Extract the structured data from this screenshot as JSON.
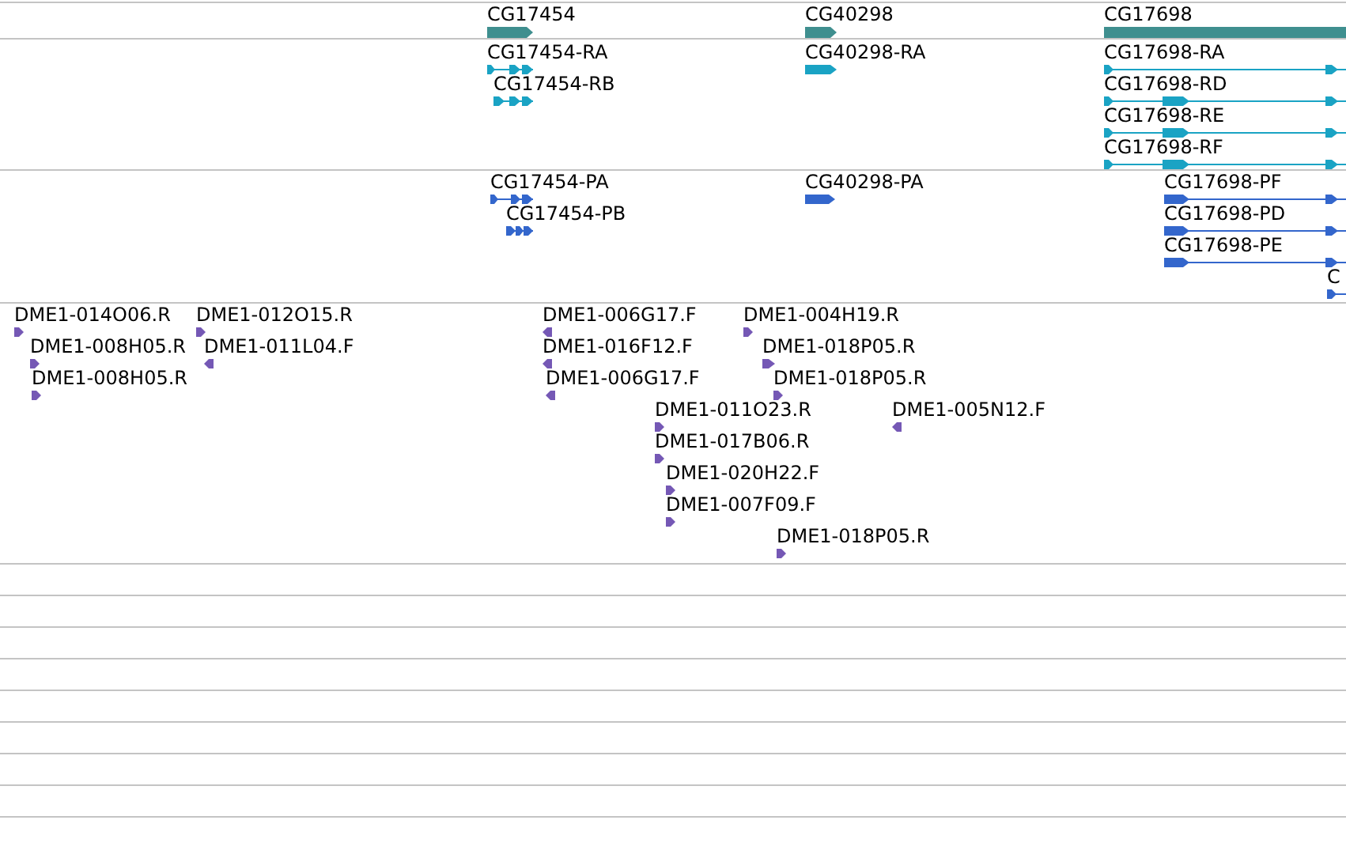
{
  "tracks": [
    {
      "kind": "gene",
      "features": [
        {
          "label": "CG17454",
          "forward": true
        },
        {
          "label": "CG40298",
          "forward": true
        },
        {
          "label": "CG17698",
          "forward": true
        }
      ]
    },
    {
      "kind": "transcript",
      "features": [
        {
          "label": "CG17454-RA",
          "forward": true
        },
        {
          "label": "CG17454-RB",
          "forward": true
        },
        {
          "label": "CG40298-RA",
          "forward": true
        },
        {
          "label": "CG17698-RA",
          "forward": true
        },
        {
          "label": "CG17698-RD",
          "forward": true
        },
        {
          "label": "CG17698-RE",
          "forward": true
        },
        {
          "label": "CG17698-RF",
          "forward": true
        }
      ]
    },
    {
      "kind": "protein",
      "features": [
        {
          "label": "CG17454-PA",
          "forward": true
        },
        {
          "label": "CG17454-PB",
          "forward": true
        },
        {
          "label": "CG40298-PA",
          "forward": true
        },
        {
          "label": "CG17698-PF",
          "forward": true
        },
        {
          "label": "CG17698-PD",
          "forward": true
        },
        {
          "label": "CG17698-PE",
          "forward": true
        },
        {
          "label": "C",
          "forward": true
        }
      ]
    },
    {
      "kind": "est",
      "features": [
        {
          "label": "DME1-014O06.R",
          "forward": true
        },
        {
          "label": "DME1-008H05.R",
          "forward": true
        },
        {
          "label": "DME1-008H05.R",
          "forward": true
        },
        {
          "label": "DME1-012O15.R",
          "forward": true
        },
        {
          "label": "DME1-011L04.F",
          "forward": false
        },
        {
          "label": "DME1-006G17.F",
          "forward": false
        },
        {
          "label": "DME1-016F12.F",
          "forward": false
        },
        {
          "label": "DME1-006G17.F",
          "forward": false
        },
        {
          "label": "DME1-004H19.R",
          "forward": true
        },
        {
          "label": "DME1-018P05.R",
          "forward": true
        },
        {
          "label": "DME1-018P05.R",
          "forward": true
        },
        {
          "label": "DME1-011O23.R",
          "forward": true
        },
        {
          "label": "DME1-005N12.F",
          "forward": false
        },
        {
          "label": "DME1-017B06.R",
          "forward": true
        },
        {
          "label": "DME1-020H22.F",
          "forward": true
        },
        {
          "label": "DME1-007F09.F",
          "forward": true
        },
        {
          "label": "DME1-018P05.R",
          "forward": true
        }
      ]
    },
    {
      "kind": "empty"
    },
    {
      "kind": "empty"
    },
    {
      "kind": "empty"
    },
    {
      "kind": "empty"
    },
    {
      "kind": "empty"
    },
    {
      "kind": "empty"
    },
    {
      "kind": "empty"
    },
    {
      "kind": "empty"
    },
    {
      "kind": "empty"
    }
  ]
}
